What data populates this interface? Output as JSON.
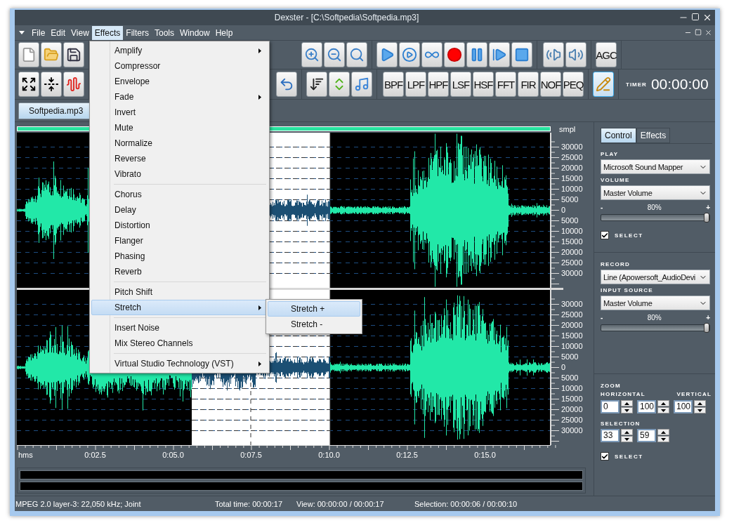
{
  "window": {
    "title": "Dexster - [C:\\Softpedia\\Softpedia.mp3]"
  },
  "menu_bar": [
    {
      "label": "File",
      "selected": false
    },
    {
      "label": "Edit",
      "selected": false
    },
    {
      "label": "View",
      "selected": false
    },
    {
      "label": "Effects",
      "selected": true
    },
    {
      "label": "Filters",
      "selected": false
    },
    {
      "label": "Tools",
      "selected": false
    },
    {
      "label": "Window",
      "selected": false
    },
    {
      "label": "Help",
      "selected": false
    }
  ],
  "toolbar": {
    "agc": "AGC",
    "filters": [
      "BPF",
      "LPF",
      "HPF",
      "LSF",
      "HSF",
      "FFT",
      "FIR",
      "NOF",
      "PEQ"
    ],
    "pencil_selected": true,
    "timer_label": "TIMER",
    "timer_value": "00:00:00"
  },
  "document_tabs": [
    {
      "label": "Softpedia.mp3",
      "selected": true
    }
  ],
  "waveform": {
    "unit": "smpl",
    "channels": [
      {
        "axis_labels": [
          "30000",
          "25000",
          "20000",
          "15000",
          "10000",
          "5000",
          "0",
          "5000",
          "10000",
          "15000",
          "20000",
          "25000",
          "30000"
        ]
      },
      {
        "axis_labels": [
          "30000",
          "25000",
          "20000",
          "15000",
          "10000",
          "5000",
          "0",
          "5000",
          "10000",
          "15000",
          "20000",
          "25000",
          "30000"
        ]
      }
    ],
    "time_labels": [
      "hms",
      "0:02.5",
      "0:05.0",
      "0:07.5",
      "0:10.0",
      "0:12.5",
      "0:15.0"
    ]
  },
  "effects_menu": [
    {
      "kind": "item",
      "label": "Amplify",
      "submenu": true,
      "selected": false
    },
    {
      "kind": "item",
      "label": "Compressor",
      "submenu": false,
      "selected": false
    },
    {
      "kind": "item",
      "label": "Envelope",
      "submenu": false,
      "selected": false
    },
    {
      "kind": "item",
      "label": "Fade",
      "submenu": true,
      "selected": false
    },
    {
      "kind": "item",
      "label": "Invert",
      "submenu": false,
      "selected": false
    },
    {
      "kind": "item",
      "label": "Mute",
      "submenu": false,
      "selected": false
    },
    {
      "kind": "item",
      "label": "Normalize",
      "submenu": false,
      "selected": false
    },
    {
      "kind": "item",
      "label": "Reverse",
      "submenu": false,
      "selected": false
    },
    {
      "kind": "item",
      "label": "Vibrato",
      "submenu": false,
      "selected": false
    },
    {
      "kind": "separator"
    },
    {
      "kind": "item",
      "label": "Chorus",
      "submenu": false,
      "selected": false
    },
    {
      "kind": "item",
      "label": "Delay",
      "submenu": false,
      "selected": false
    },
    {
      "kind": "item",
      "label": "Distortion",
      "submenu": false,
      "selected": false
    },
    {
      "kind": "item",
      "label": "Flanger",
      "submenu": false,
      "selected": false
    },
    {
      "kind": "item",
      "label": "Phasing",
      "submenu": false,
      "selected": false
    },
    {
      "kind": "item",
      "label": "Reverb",
      "submenu": false,
      "selected": false
    },
    {
      "kind": "separator"
    },
    {
      "kind": "item",
      "label": "Pitch Shift",
      "submenu": false,
      "selected": false
    },
    {
      "kind": "item",
      "label": "Stretch",
      "submenu": true,
      "selected": true
    },
    {
      "kind": "separator"
    },
    {
      "kind": "item",
      "label": "Insert Noise",
      "submenu": false,
      "selected": false
    },
    {
      "kind": "item",
      "label": "Mix Stereo Channels",
      "submenu": false,
      "selected": false
    },
    {
      "kind": "separator"
    },
    {
      "kind": "item",
      "label": "Virtual Studio Technology (VST)",
      "submenu": true,
      "selected": false
    }
  ],
  "stretch_submenu": [
    {
      "label": "Stretch +",
      "selected": true
    },
    {
      "label": "Stretch -",
      "selected": false
    }
  ],
  "side_panel": {
    "tabs": [
      {
        "label": "Control",
        "selected": true
      },
      {
        "label": "Effects",
        "selected": false
      }
    ],
    "play_label": "PLAY",
    "play_device": "Microsoft Sound Mapper",
    "volume_label": "VOLUME",
    "volume_source": "Master Volume",
    "volume": {
      "minus": "-",
      "reading": "80%",
      "plus": "+",
      "level": 1
    },
    "select_1": {
      "label": "SELECT",
      "checked": true
    },
    "record_label": "RECORD",
    "record_device": "Line (Apowersoft_AudioDevi",
    "input_label": "INPUT SOURCE",
    "input_source": "Master Volume",
    "input_volume": {
      "minus": "-",
      "reading": "80%",
      "plus": "+",
      "level": 1
    },
    "zoom_label": "ZOOM",
    "horizontal_label": "HORIZONTAL",
    "vertical_label": "VERTICAL",
    "horizontal_values": [
      "0",
      "100"
    ],
    "vertical_value": "100",
    "selection_label": "SELECTION",
    "selection_values": [
      "33",
      "59"
    ],
    "select_2": {
      "label": "SELECT",
      "checked": true
    }
  },
  "status_bar": [
    "MPEG 2.0 layer-3: 22,050 kHz; Joint",
    "Total time: 00:00:17",
    "View: 00:00:00 / 00:00:17",
    "Selection: 00:00:06 / 00:00:10"
  ]
}
